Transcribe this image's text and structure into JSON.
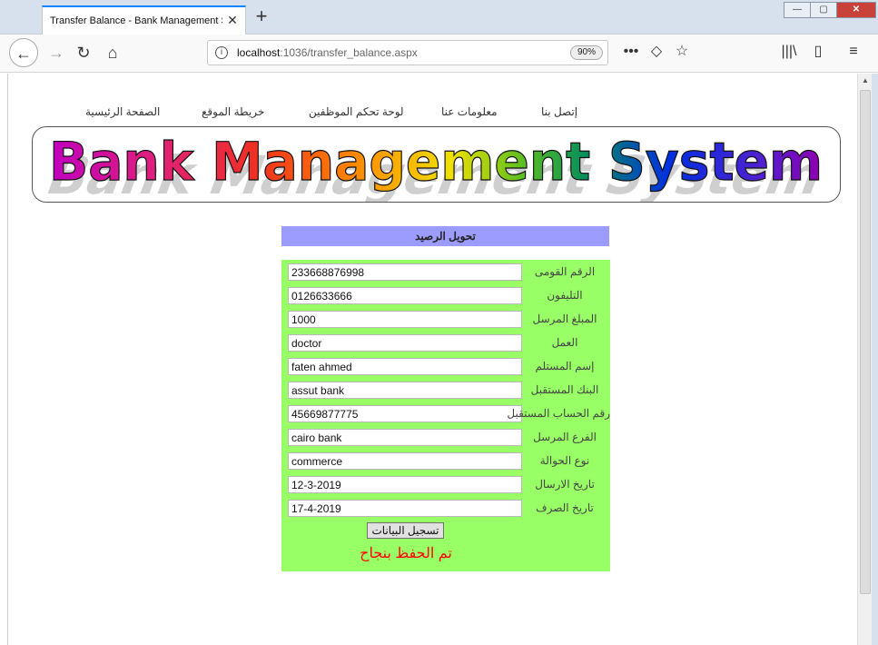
{
  "browser": {
    "tab_title": "Transfer Balance - Bank Management System",
    "tab_close_icon": "close-icon",
    "new_tab_label": "+",
    "window_controls": {
      "minimize": "—",
      "maximize": "▢",
      "close": "✕"
    },
    "back_label": "←",
    "forward_label": "→",
    "reload_label": "↻",
    "home_label": "⌂",
    "url_host": "localhost",
    "url_path": ":1036/transfer_balance.aspx",
    "zoom": "90%",
    "more_label": "•••",
    "pocket_label": "◇",
    "bookmark_label": "☆",
    "library_label": "|||\\",
    "sidebar_label": "▯",
    "menu_label": "≡"
  },
  "site_menu": {
    "home": "الصفحة الرئيسية",
    "sitemap": "خريطة الموقع",
    "employee_panel": "لوحة تحكم الموظفين",
    "about": "معلومات عنا",
    "contact": "إتصل بنا"
  },
  "banner": {
    "text": "Bank Management System"
  },
  "form": {
    "title": "تحويل الرصيد",
    "fields": [
      {
        "label": "الرقم القومى",
        "value": "233668876998"
      },
      {
        "label": "التليفون",
        "value": "0126633666"
      },
      {
        "label": "المبلغ المرسل",
        "value": "1000"
      },
      {
        "label": "العمل",
        "value": "doctor"
      },
      {
        "label": "إسم المستلم",
        "value": "faten ahmed"
      },
      {
        "label": "البنك المستقبل",
        "value": "assut bank"
      },
      {
        "label": "رقم الحساب المستقبل",
        "value": "45669877775"
      },
      {
        "label": "الفرع المرسل",
        "value": "cairo bank"
      },
      {
        "label": "نوع الحوالة",
        "value": "commerce"
      },
      {
        "label": "تاريخ الارسال",
        "value": "12-3-2019"
      },
      {
        "label": "تاريخ الصرف",
        "value": "17-4-2019"
      }
    ],
    "submit_label": "تسجيل البيانات",
    "success_message": "تم الحفظ بنجاح"
  }
}
